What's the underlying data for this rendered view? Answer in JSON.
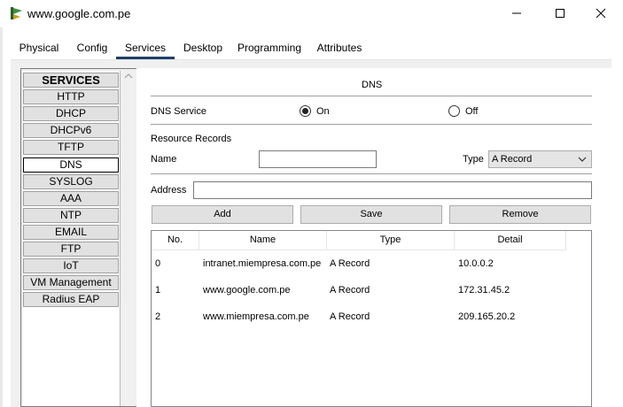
{
  "window": {
    "title": "www.google.com.pe"
  },
  "tabs": [
    {
      "label": "Physical"
    },
    {
      "label": "Config"
    },
    {
      "label": "Services",
      "active": true
    },
    {
      "label": "Desktop"
    },
    {
      "label": "Programming"
    },
    {
      "label": "Attributes"
    }
  ],
  "services": {
    "header": "SERVICES",
    "items": [
      "HTTP",
      "DHCP",
      "DHCPv6",
      "TFTP",
      "DNS",
      "SYSLOG",
      "AAA",
      "NTP",
      "EMAIL",
      "FTP",
      "IoT",
      "VM Management",
      "Radius EAP"
    ],
    "selected": "DNS"
  },
  "dns": {
    "title": "DNS",
    "service_label": "DNS Service",
    "on_label": "On",
    "off_label": "Off",
    "service_state": "On",
    "resource_records_label": "Resource Records",
    "name_label": "Name",
    "name_value": "",
    "type_label": "Type",
    "type_value": "A Record",
    "address_label": "Address",
    "address_value": "",
    "add_button": "Add",
    "save_button": "Save",
    "remove_button": "Remove"
  },
  "table": {
    "columns": [
      "No.",
      "Name",
      "Type",
      "Detail"
    ],
    "rows": [
      {
        "no": "0",
        "name": "intranet.miempresa.com.pe",
        "type": "A Record",
        "detail": "10.0.0.2"
      },
      {
        "no": "1",
        "name": "www.google.com.pe",
        "type": "A Record",
        "detail": "172.31.45.2"
      },
      {
        "no": "2",
        "name": "www.miempresa.com.pe",
        "type": "A Record",
        "detail": "209.165.20.2"
      }
    ]
  },
  "colors": {
    "active_tab_underline": "#1e3f66",
    "panel_bg": "#f0f0f0"
  },
  "icons": [
    "app-icon",
    "minimize-icon",
    "maximize-icon",
    "close-icon",
    "scroll-up-icon",
    "chevron-down-icon"
  ]
}
